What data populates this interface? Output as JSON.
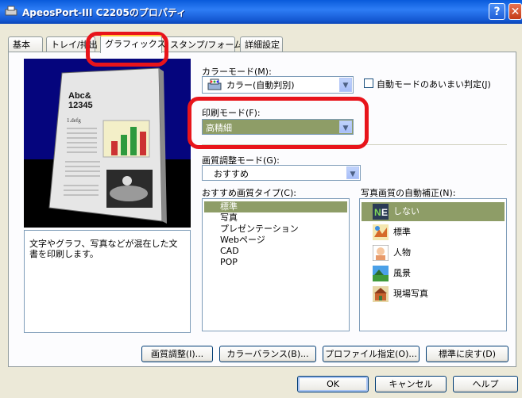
{
  "window": {
    "title": "ApeosPort-III C2205のプロパティ",
    "help_label": "?",
    "close_label": "✕"
  },
  "tabs": [
    {
      "label": "基本"
    },
    {
      "label": "トレイ/排出"
    },
    {
      "label": "グラフィックス"
    },
    {
      "label": "スタンプ/フォーム"
    },
    {
      "label": "詳細設定"
    }
  ],
  "active_tab": "グラフィックス",
  "preview": {
    "heading_line1": "Abc&",
    "heading_line2": "12345",
    "subheading": "1.defg",
    "description": "文字やグラフ、写真などが混在した文書を印刷します。"
  },
  "color_mode": {
    "label": "カラーモード(M):",
    "value": "カラー(自動判別)",
    "auto_checkbox_label": "自動モードのあいまい判定(J)",
    "auto_checked": false
  },
  "print_mode": {
    "label": "印刷モード(F):",
    "value": "高精細"
  },
  "quality_mode": {
    "label": "画質調整モード(G):",
    "value": "おすすめ"
  },
  "recommended_type": {
    "label": "おすすめ画質タイプ(C):",
    "items": [
      "標準",
      "写真",
      "プレゼンテーション",
      "Webページ",
      "CAD",
      "POP"
    ],
    "selected": 0
  },
  "auto_correction": {
    "label": "写真画質の自動補正(N):",
    "items": [
      {
        "label": "しない",
        "icon": "none-icon"
      },
      {
        "label": "標準",
        "icon": "standard-photo-icon"
      },
      {
        "label": "人物",
        "icon": "person-photo-icon"
      },
      {
        "label": "風景",
        "icon": "landscape-photo-icon"
      },
      {
        "label": "現場写真",
        "icon": "site-photo-icon"
      }
    ],
    "selected": 0
  },
  "panel_buttons": {
    "quality": "画質調整(I)...",
    "color_balance": "カラーバランス(B)...",
    "profile": "プロファイル指定(O)...",
    "reset": "標準に戻す(D)"
  },
  "dialog_buttons": {
    "ok": "OK",
    "cancel": "キャンセル",
    "help": "ヘルプ"
  },
  "colors": {
    "selection": "#8e9d67",
    "highlight": "#e8141b",
    "titlebar": "#0a5bdb"
  }
}
